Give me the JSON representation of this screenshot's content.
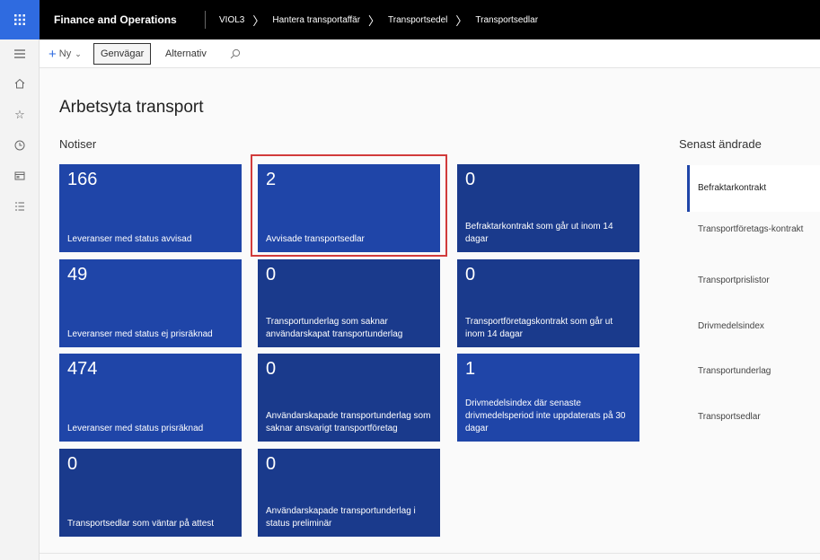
{
  "topbar": {
    "app_name": "Finance and Operations",
    "breadcrumbs": [
      "VIOL3",
      "Hantera transportaffär",
      "Transportsedel",
      "Transportsedlar"
    ],
    "separator": "〉"
  },
  "actions": {
    "new_label": "Ny",
    "shortcuts_label": "Genvägar",
    "options_label": "Alternativ"
  },
  "page": {
    "title": "Arbetsyta transport",
    "notices_title": "Notiser",
    "recent_title": "Senast ändrade"
  },
  "tiles": [
    {
      "count": "166",
      "label": "Leveranser med status avvisad"
    },
    {
      "count": "2",
      "label": "Avvisade transportsedlar"
    },
    {
      "count": "0",
      "label": "Befraktarkontrakt som går ut inom 14 dagar"
    },
    {
      "count": "49",
      "label": "Leveranser med status ej prisräknad"
    },
    {
      "count": "0",
      "label": "Transportunderlag som saknar användarskapat transportunderlag"
    },
    {
      "count": "0",
      "label": "Transportföretagskontrakt som går ut inom 14 dagar"
    },
    {
      "count": "474",
      "label": "Leveranser med status prisräknad"
    },
    {
      "count": "0",
      "label": "Användarskapade transportunderlag som saknar ansvarigt transportföretag"
    },
    {
      "count": "1",
      "label": "Drivmedelsindex där senaste drivmedelsperiod inte uppdaterats på 30 dagar"
    },
    {
      "count": "0",
      "label": "Transportsedlar som väntar på attest"
    },
    {
      "count": "0",
      "label": "Användarskapade transportunderlag i status preliminär"
    }
  ],
  "recent": [
    {
      "label": "Befraktarkontrakt"
    },
    {
      "label": "Transportföretags-kontrakt"
    },
    {
      "label": "Transportprislistor"
    },
    {
      "label": "Drivmedelsindex"
    },
    {
      "label": "Transportunderlag"
    },
    {
      "label": "Transportsedlar"
    }
  ],
  "colors": {
    "tile_primary": "#1f45a8",
    "tile_dark": "#1a3a8c",
    "accent": "#2f6be0",
    "highlight": "#d13b3b"
  }
}
